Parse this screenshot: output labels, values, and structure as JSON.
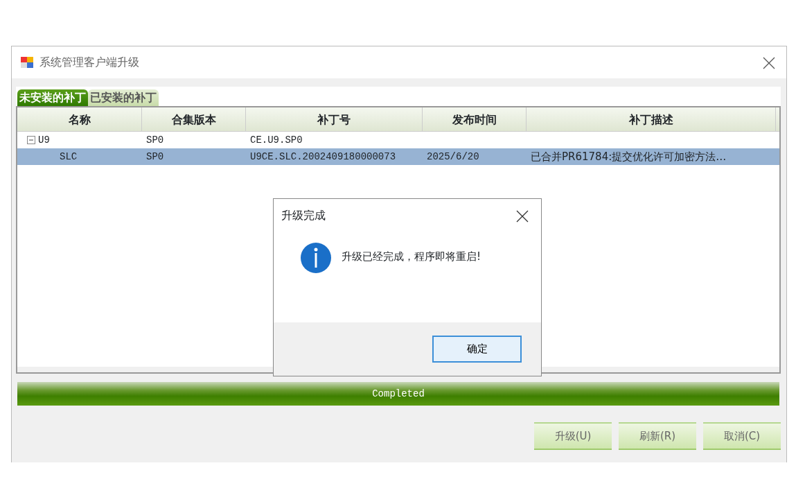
{
  "window": {
    "title": "系统管理客户端升级"
  },
  "tabs": [
    {
      "label": "未安装的补丁",
      "selected": true
    },
    {
      "label": "已安装的补丁",
      "selected": false
    }
  ],
  "table": {
    "columns": [
      "名称",
      "合集版本",
      "补丁号",
      "发布时间",
      "补丁描述"
    ],
    "rows": [
      {
        "cells": [
          "U9",
          "SP0",
          "CE.U9.SP0",
          "",
          ""
        ],
        "expanded": true,
        "selected": false,
        "children": [
          {
            "cells": [
              "SLC",
              "SP0",
              "U9CE.SLC.2002409180000073",
              "2025/6/20",
              "已合并PR61784:提交优化许可加密方法…"
            ],
            "selected": true
          }
        ]
      }
    ]
  },
  "progress": {
    "level": 1,
    "text": "Completed"
  },
  "buttons": [
    "升级(U)",
    "刷新(R)",
    "取消(C)"
  ],
  "dialog": {
    "title": "升级完成",
    "message": "升级已经完成，程序即将重启!",
    "button": "确定"
  }
}
